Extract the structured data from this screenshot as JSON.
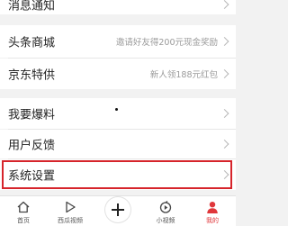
{
  "menu": {
    "notifications": {
      "label": "消息通知"
    },
    "mall": {
      "label": "头条商城",
      "hint": "邀请好友得200元现金奖励"
    },
    "jd": {
      "label": "京东特供",
      "hint": "新人领188元红包"
    },
    "report": {
      "label": "我要爆料"
    },
    "feedback": {
      "label": "用户反馈"
    },
    "settings": {
      "label": "系统设置"
    }
  },
  "tabbar": {
    "home": "首页",
    "xigua": "西瓜视频",
    "mini_video": "小视频",
    "mine": "我的"
  },
  "colors": {
    "accent": "#e0373b",
    "highlight_border": "#d6242b"
  },
  "icons": {
    "home": "home-icon",
    "xigua": "play-icon",
    "publish": "plus-icon",
    "mini_video": "mini-video-icon",
    "mine": "person-icon",
    "row": "chevron-right-icon"
  }
}
